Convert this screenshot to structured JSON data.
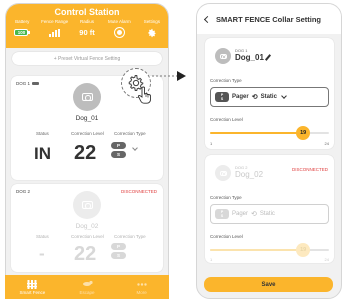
{
  "colors": {
    "accent": "#fbb52c",
    "battery_green": "#48b84c",
    "disconnected_red": "#e04040",
    "chip_gray": "#666666"
  },
  "control_station": {
    "title": "Control Station",
    "stats": [
      {
        "label": "Battery",
        "value": "100",
        "icon": "battery-icon"
      },
      {
        "label": "Fence Range",
        "icon": "signal-bars-icon"
      },
      {
        "label": "Radius",
        "value": "90 ft"
      },
      {
        "label": "Mute Alarm",
        "icon": "mute-alarm-icon"
      },
      {
        "label": "Settings",
        "icon": "gear-icon"
      }
    ],
    "preset_button": "+ Preset Virtual Fence Setting",
    "columns": {
      "status": "Status",
      "level": "Correction Level",
      "type": "Correction Type"
    },
    "dogs": [
      {
        "tag": "DOG 1",
        "name": "Dog_01",
        "status_value": "IN",
        "level_value": "22",
        "type_top": "P",
        "type_bottom": "S",
        "connected": true
      },
      {
        "tag": "DOG 2",
        "name": "Dog_02",
        "status_value": "-",
        "level_value": "22",
        "type_top": "P",
        "type_bottom": "S",
        "connected": false,
        "disconnected_label": "DISCONNECTED"
      }
    ],
    "nav": [
      {
        "label": "Smart Fence",
        "icon": "fence-grid-icon",
        "active": true
      },
      {
        "label": "Escape",
        "icon": "running-dog-icon",
        "active": false
      },
      {
        "label": "More",
        "icon": "more-dots-icon",
        "active": false
      }
    ]
  },
  "collar_setting": {
    "title": "SMART FENCE Collar Setting",
    "connection_type_label": "Correction Type",
    "correction_level_label": "Correction Level",
    "save_label": "Save",
    "cards": [
      {
        "tag": "DOG 1",
        "name": "Dog_01",
        "type_text": "Pager",
        "type_mode": "Static",
        "level": 19,
        "min": "1",
        "max": "24",
        "connected": true
      },
      {
        "tag": "DOG 2",
        "name": "Dog_02",
        "type_text": "Pager",
        "type_mode": "Static",
        "level": 19,
        "min": "1",
        "max": "24",
        "connected": false,
        "disconnected_label": "DISCONNECTED"
      }
    ]
  }
}
